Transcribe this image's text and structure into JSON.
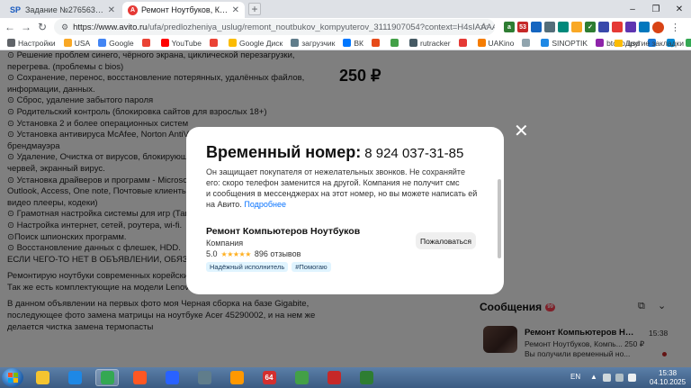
{
  "browser": {
    "tabs": [
      {
        "icon": "SP",
        "label": "Задание №2765636 - просмотр з"
      },
      {
        "icon": "A",
        "label": "Ремонт Ноутбуков, Компьютеров"
      }
    ],
    "new_tab_symbol": "+",
    "window_controls": {
      "minimize": "–",
      "maximize": "❐",
      "close": "✕"
    },
    "url": {
      "host": "https://www.avito.ru",
      "path": "/ufa/predlozheniya_uslug/remont_noutbukov_kompyuterov_3111907054?context=H4sIAAAAAAA_wE_AM..."
    },
    "extensions": [
      {
        "label": "a",
        "color": "#2e7d32"
      },
      {
        "label": "53",
        "color": "#c62828"
      },
      {
        "label": "",
        "color": "#1565c0"
      },
      {
        "label": "",
        "color": "#546e7a"
      },
      {
        "label": "",
        "color": "#00897b"
      },
      {
        "label": "",
        "color": "#f9a825"
      },
      {
        "label": "✓",
        "color": "#2e7d32"
      },
      {
        "label": "",
        "color": "#3949ab"
      },
      {
        "label": "",
        "color": "#e53935"
      },
      {
        "label": "",
        "color": "#5e35b1"
      },
      {
        "label": "",
        "color": "#0277bd"
      }
    ],
    "bookmarks": [
      {
        "label": "Настройки",
        "color": "#5f6368"
      },
      {
        "label": "USA",
        "color": "#f9a825"
      },
      {
        "label": "Google",
        "color": "#4285f4"
      },
      {
        "label": "",
        "color": "#ea4335"
      },
      {
        "label": "YouTube",
        "color": "#ff0000"
      },
      {
        "label": "",
        "color": "#ea4335"
      },
      {
        "label": "Google Диск",
        "color": "#fbbc04"
      },
      {
        "label": "загрузчик",
        "color": "#607d8b"
      },
      {
        "label": "ВК",
        "color": "#0077ff"
      },
      {
        "label": "",
        "color": "#e64a19"
      },
      {
        "label": "",
        "color": "#43a047"
      },
      {
        "label": "rutracker",
        "color": "#455a64"
      },
      {
        "label": "",
        "color": "#e53935"
      },
      {
        "label": "UAKino",
        "color": "#f57c00"
      },
      {
        "label": "",
        "color": "#90a4ae"
      },
      {
        "label": "SINOPTIK",
        "color": "#1e88e5"
      },
      {
        "label": "btc to usd",
        "color": "#8e24aa"
      },
      {
        "label": "",
        "color": "#1976d2"
      },
      {
        "label": "",
        "color": "#0288d1"
      },
      {
        "label": "maps",
        "color": "#34a853"
      },
      {
        "label": "",
        "color": "#5f6368"
      }
    ],
    "other_bookmarks": "Другие закладки"
  },
  "listing": {
    "description_lines": [
      "⊙ Решение проблем синего, чёрного экрана, циклической перезагрузки,",
      "перегрева. (проблемы с bios)",
      "⊙ Сохранение, перенос, восстановление потерянных, удалённых файлов,",
      "информации, данных.",
      "⊙ Сброс, удаление забытого пароля",
      "⊙ Родительский контроль (блокировка сайтов для взрослых 18+)",
      "⊙ Установка 2 и более операционных систем",
      "⊙ Установка антивируса McAfee, Norton AntiVirus",
      "брендмауэра",
      "⊙ Удаление, Очистка от вирусов, блокирующих",
      "червей, экранный вирус.",
      "⊙ Установка драйверов и программ - Microsoft",
      "Outlook, Access, One note, Почтовые клиенты,",
      "видео плееры, кодеки)",
      "⊙ Грамотная настройка системы для игр (Тан",
      "⊙ Настройка интернет, сетей, роутера, wi-fi.",
      "⊙Поиск шпионских программ.",
      "⊙ Восстановление данных с флешек, HDD.",
      "ЕСЛИ ЧЕГО-ТО НЕТ В ОБЪЯВЛЕНИИ, ОБЯЗАТЕЛ"
    ],
    "description_extra": [
      "Ремонтирую ноутбуки современных корейских и китайских брендов.",
      "Так же есть комплектующие на модели Lenovo, Dell, ASU's, HP"
    ],
    "description_extra2": [
      "В данном объявлении на первых фото моя Черная сборка на базе Gigabite,",
      "последующее фото замена матрицы на ноутбуке Acer 45290002, и на нем же",
      "делается чистка замена термопасты"
    ],
    "price": "250 ₽"
  },
  "messages": {
    "title": "Сообщения",
    "badge": "99",
    "item": {
      "title": "Ремонт Компьютеров Ноу...",
      "time": "15:38",
      "subtitle": "Ремонт Ноутбуков, Компь...  250 ₽",
      "preview": "Вы получили временный но..."
    }
  },
  "modal": {
    "title": "Временный номер:",
    "number": "8 924 037-31-85",
    "text_lines": [
      "Он защищает покупателя от нежелательных звонков. Не сохраняйте",
      "его: скоро телефон заменится на другой. Компания не получит смс",
      "и сообщения в мессенджерах на этот номер, но вы можете написать ей",
      "на Авито."
    ],
    "link": "Подробнее",
    "seller_name": "Ремонт Компьютеров Ноутбуков",
    "seller_type": "Компания",
    "rating": "5.0",
    "stars": "★★★★★",
    "reviews": "896 отзывов",
    "badges": [
      "Надёжный исполнитель",
      "#Помогаю"
    ],
    "complain_label": "Пожаловаться",
    "close_symbol": "✕"
  },
  "taskbar": {
    "apps": [
      {
        "label": "",
        "color": "#f4c430"
      },
      {
        "label": "",
        "color": "#1e88e5"
      },
      {
        "label": "",
        "color": "#34a853"
      },
      {
        "label": "",
        "color": "#ff5722"
      },
      {
        "label": "",
        "color": "#2962ff"
      },
      {
        "label": "",
        "color": "#607d8b"
      },
      {
        "label": "",
        "color": "#ff9800"
      },
      {
        "label": "64",
        "color": "#d32f2f"
      },
      {
        "label": "",
        "color": "#43a047"
      },
      {
        "label": "",
        "color": "#c62828"
      },
      {
        "label": "",
        "color": "#2e7d32"
      }
    ],
    "lang": "EN",
    "time": "15:38",
    "date": "04.10.2025"
  }
}
